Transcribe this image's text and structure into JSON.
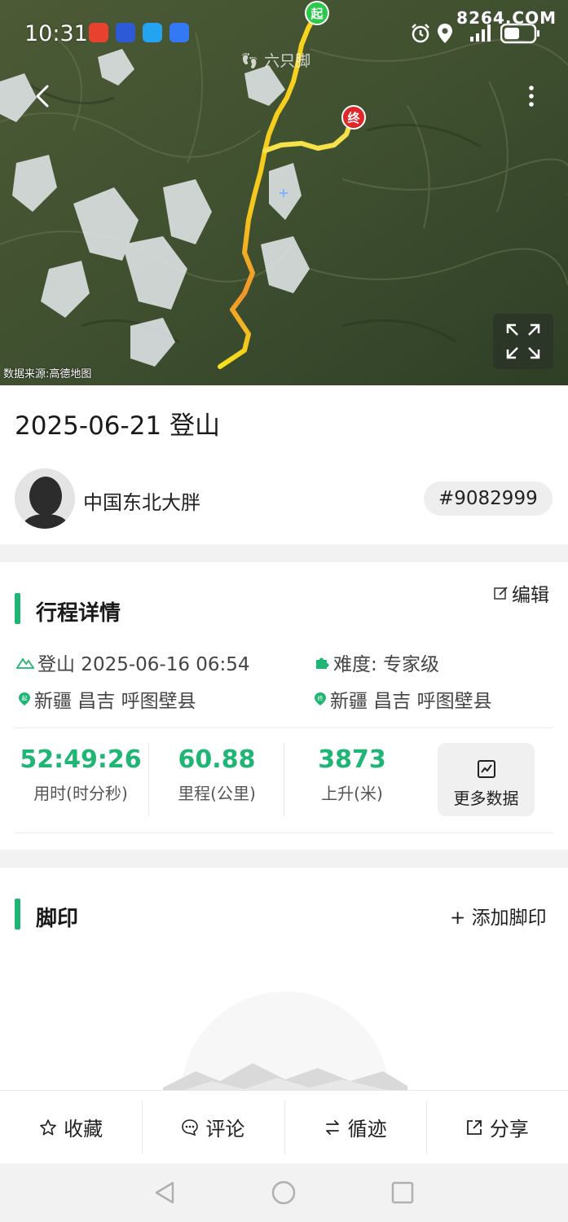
{
  "status_bar": {
    "time": "10:31",
    "site_watermark": "8264.COM"
  },
  "map": {
    "app_watermark": "六只脚",
    "start_marker": "起",
    "end_marker": "终",
    "source_note": "数据来源:高德地图"
  },
  "trip": {
    "title": "2025-06-21 登山",
    "user_name": "中国东北大胖",
    "trip_id": "#9082999"
  },
  "details": {
    "section_title": "行程详情",
    "edit_label": "编辑",
    "activity": "登山 2025-06-16 06:54",
    "difficulty": "难度:  专家级",
    "start_location": "新疆 昌吉 呼图壁县",
    "end_location": "新疆 昌吉 呼图壁县",
    "stats": [
      {
        "value": "52:49:26",
        "label": "用时(时分秒)"
      },
      {
        "value": "60.88",
        "label": "里程(公里)"
      },
      {
        "value": "3873",
        "label": "上升(米)"
      }
    ],
    "more_data_label": "更多数据"
  },
  "footprint": {
    "section_title": "脚印",
    "add_label": "+ 添加脚印"
  },
  "actions": {
    "favorite": "收藏",
    "comment": "评论",
    "follow_track": "循迹",
    "share": "分享"
  },
  "colors": {
    "accent_green": "#1fb574",
    "start_green": "#2bc94a",
    "end_red": "#e0262a",
    "track_yellow": "#f5d21c",
    "track_orange": "#f08a24"
  }
}
